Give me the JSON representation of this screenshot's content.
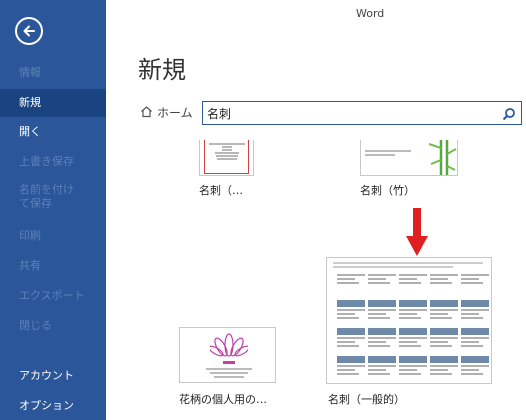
{
  "app": {
    "title": "Word"
  },
  "sidebar": {
    "items": [
      {
        "label": "情報"
      },
      {
        "label": "新規"
      },
      {
        "label": "開く"
      },
      {
        "label": "上書き保存"
      },
      {
        "label": "名前を付けて保存"
      },
      {
        "label": "印刷"
      },
      {
        "label": "共有"
      },
      {
        "label": "エクスポート"
      },
      {
        "label": "閉じる"
      },
      {
        "label": "アカウント"
      },
      {
        "label": "オプション"
      }
    ],
    "active": "新規"
  },
  "main": {
    "title": "新規",
    "breadcrumb": {
      "home_label": "ホーム"
    },
    "search": {
      "value": "名刺"
    }
  },
  "templates": [
    {
      "label": "名刺（…"
    },
    {
      "label": "名刺（竹）"
    },
    {
      "label": "花柄の個人用の…"
    },
    {
      "label": "名刺（一般的）"
    }
  ],
  "colors": {
    "sidebar": "#2b579a",
    "sidebar_active": "#194481",
    "accent_arrow": "#e02020",
    "lotus": "#c040a8"
  },
  "icons": {
    "back": "back-arrow-icon",
    "home": "home-icon",
    "search": "search-icon",
    "annotation": "red-down-arrow-icon"
  }
}
